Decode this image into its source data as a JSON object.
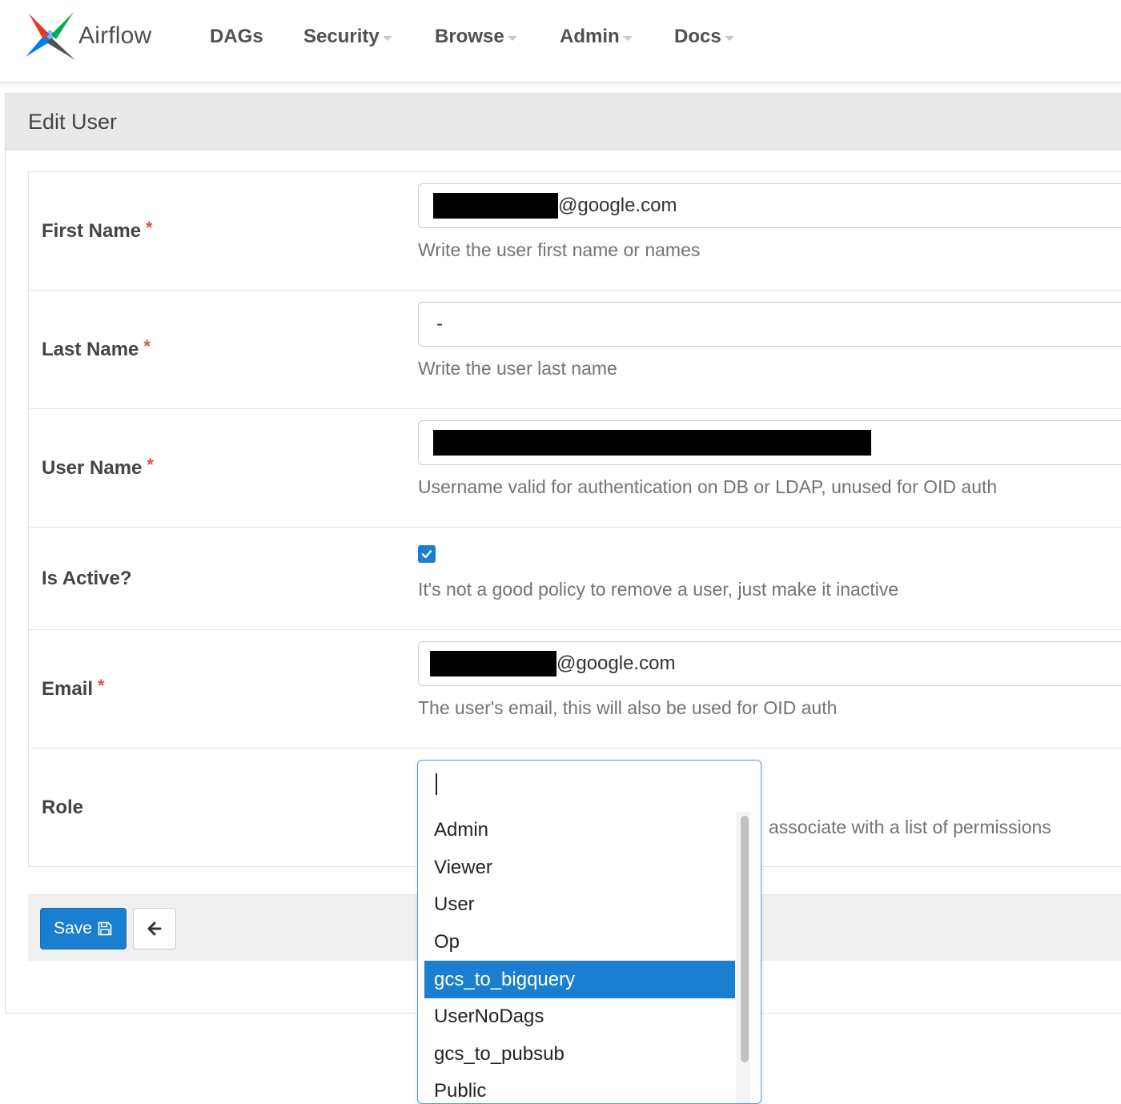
{
  "navbar": {
    "brand": "Airflow",
    "items": [
      {
        "label": "DAGs"
      },
      {
        "label": "Security"
      },
      {
        "label": "Browse"
      },
      {
        "label": "Admin"
      },
      {
        "label": "Docs"
      }
    ]
  },
  "page": {
    "title": "Edit User"
  },
  "form": {
    "first_name": {
      "label": "First Name",
      "required": "*",
      "value_suffix": "@google.com",
      "help": "Write the user first name or names"
    },
    "last_name": {
      "label": "Last Name",
      "required": "*",
      "value": "-",
      "help": "Write the user last name"
    },
    "user_name": {
      "label": "User Name",
      "required": "*",
      "help": "Username valid for authentication on DB or LDAP, unused for OID auth"
    },
    "is_active": {
      "label": "Is Active?",
      "checked": true,
      "help": "It's not a good policy to remove a user, just make it inactive"
    },
    "email": {
      "label": "Email",
      "required": "*",
      "value_suffix": "@google.com",
      "help": "The user's email, this will also be used for OID auth"
    },
    "role": {
      "label": "Role",
      "help_partial": "associate with a list of permissions",
      "options": [
        "Admin",
        "Viewer",
        "User",
        "Op",
        "gcs_to_bigquery",
        "UserNoDags",
        "gcs_to_pubsub",
        "Public"
      ],
      "highlighted": "gcs_to_bigquery"
    }
  },
  "actions": {
    "save_label": "Save"
  },
  "colors": {
    "accent": "#1a7fd1",
    "required": "#d9534f",
    "help_text": "#737373"
  },
  "icons": {
    "save": "floppy-disk-icon",
    "back": "arrow-left-icon",
    "check": "check-icon"
  }
}
